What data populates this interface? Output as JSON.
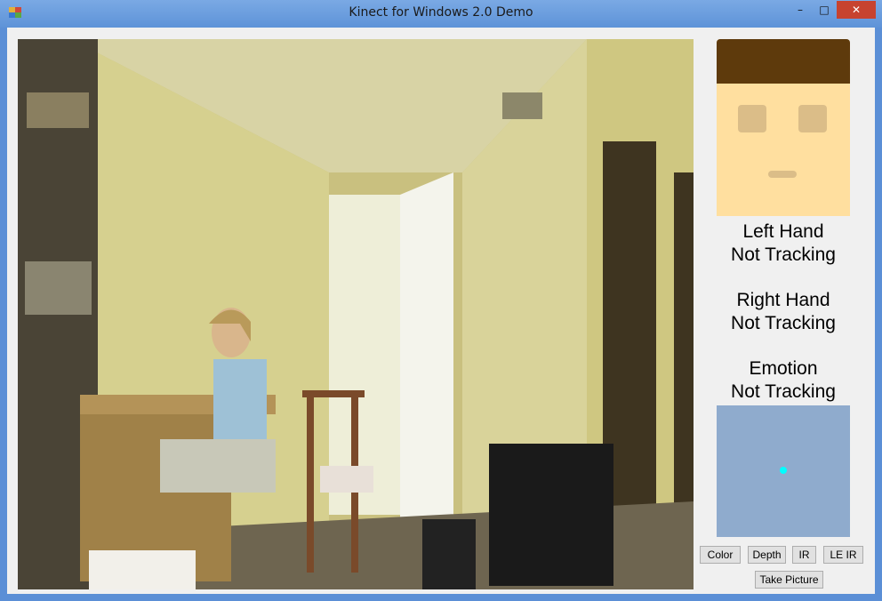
{
  "window": {
    "title": "Kinect for Windows 2.0 Demo",
    "controls": {
      "minimize": "–",
      "maximize": "□",
      "close": "✕"
    }
  },
  "sidebar": {
    "left_hand": {
      "label": "Left Hand",
      "status": "Not Tracking"
    },
    "right_hand": {
      "label": "Right Hand",
      "status": "Not Tracking"
    },
    "emotion": {
      "label": "Emotion",
      "status": "Not Tracking"
    }
  },
  "buttons": {
    "color": "Color",
    "depth": "Depth",
    "ir": "IR",
    "le_ir": "LE IR",
    "take_picture": "Take Picture"
  },
  "colors": {
    "face_skin": "#ffdf9f",
    "face_hair": "#5e3a0c",
    "face_features": "#dbbd88",
    "tracker_bg": "#8fabcd",
    "tracker_dot": "#00ffff"
  }
}
